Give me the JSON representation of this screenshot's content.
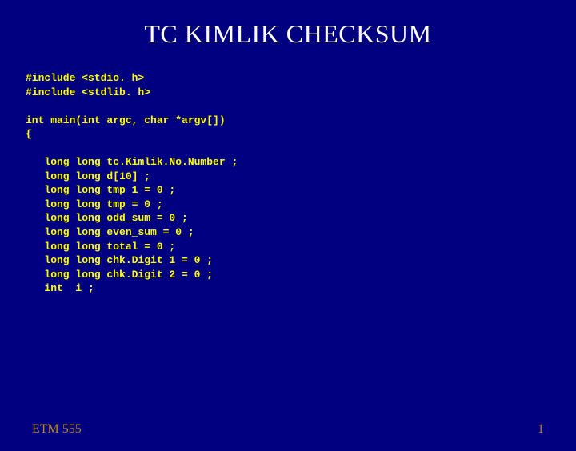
{
  "title": "TC KIMLIK CHECKSUM",
  "code": "#include <stdio. h>\n#include <stdlib. h>\n\nint main(int argc, char *argv[])\n{\n\n   long long tc.Kimlik.No.Number ;\n   long long d[10] ;\n   long long tmp 1 = 0 ;\n   long long tmp = 0 ;\n   long long odd_sum = 0 ;\n   long long even_sum = 0 ;\n   long long total = 0 ;\n   long long chk.Digit 1 = 0 ;\n   long long chk.Digit 2 = 0 ;\n   int  i ;",
  "footer": {
    "course": "ETM 555",
    "page": "1"
  }
}
